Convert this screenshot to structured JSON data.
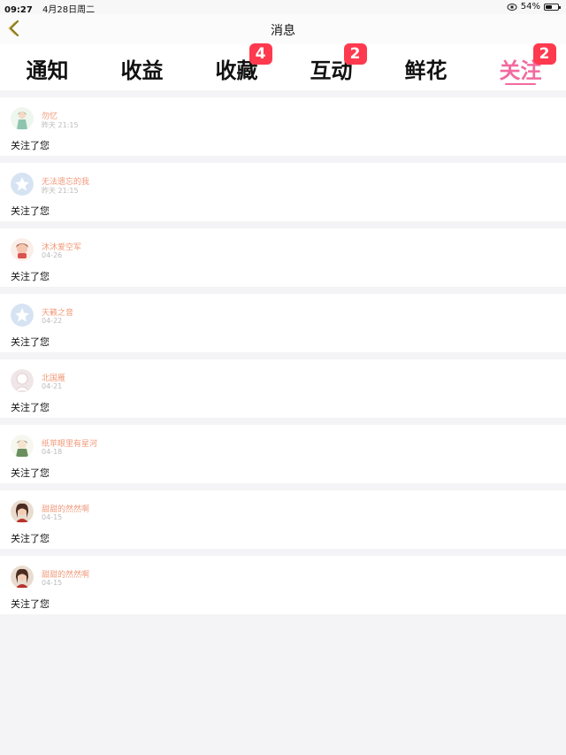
{
  "status_bar": {
    "time": "09:27",
    "date": "4月28日周二",
    "battery": "54%",
    "battery_level": 0.54
  },
  "header": {
    "title": "消息"
  },
  "tabs": [
    {
      "label": "通知",
      "badge": null,
      "active": false
    },
    {
      "label": "收益",
      "badge": null,
      "active": false
    },
    {
      "label": "收藏",
      "badge": "4",
      "active": false
    },
    {
      "label": "互动",
      "badge": "2",
      "active": false
    },
    {
      "label": "鲜花",
      "badge": null,
      "active": false
    },
    {
      "label": "关注",
      "badge": "2",
      "active": true
    }
  ],
  "colors": {
    "accent": "#f26b9f",
    "badge": "#ff3a4e",
    "name": "#f1997a"
  },
  "items": [
    {
      "name": "勿忆",
      "time": "昨天 21:15",
      "message": "关注了您",
      "avatar": "anime-girl-avatar"
    },
    {
      "name": "无法遗忘的我",
      "time": "昨天 21:15",
      "message": "关注了您",
      "avatar": "default-star-avatar"
    },
    {
      "name": "沐沐爱空军",
      "time": "04-26",
      "message": "关注了您",
      "avatar": "cartoon-avatar"
    },
    {
      "name": "天籁之音",
      "time": "04-22",
      "message": "关注了您",
      "avatar": "default-star-avatar"
    },
    {
      "name": "北国雁",
      "time": "04-21",
      "message": "关注了您",
      "avatar": "silhouette-avatar"
    },
    {
      "name": "纸苹眼里有星河",
      "time": "04-18",
      "message": "关注了您",
      "avatar": "anime-avatar"
    },
    {
      "name": "甜甜的然然啊",
      "time": "04-15",
      "message": "关注了您",
      "avatar": "portrait-avatar"
    },
    {
      "name": "甜甜的然然啊",
      "time": "04-15",
      "message": "关注了您",
      "avatar": "portrait-avatar"
    }
  ]
}
